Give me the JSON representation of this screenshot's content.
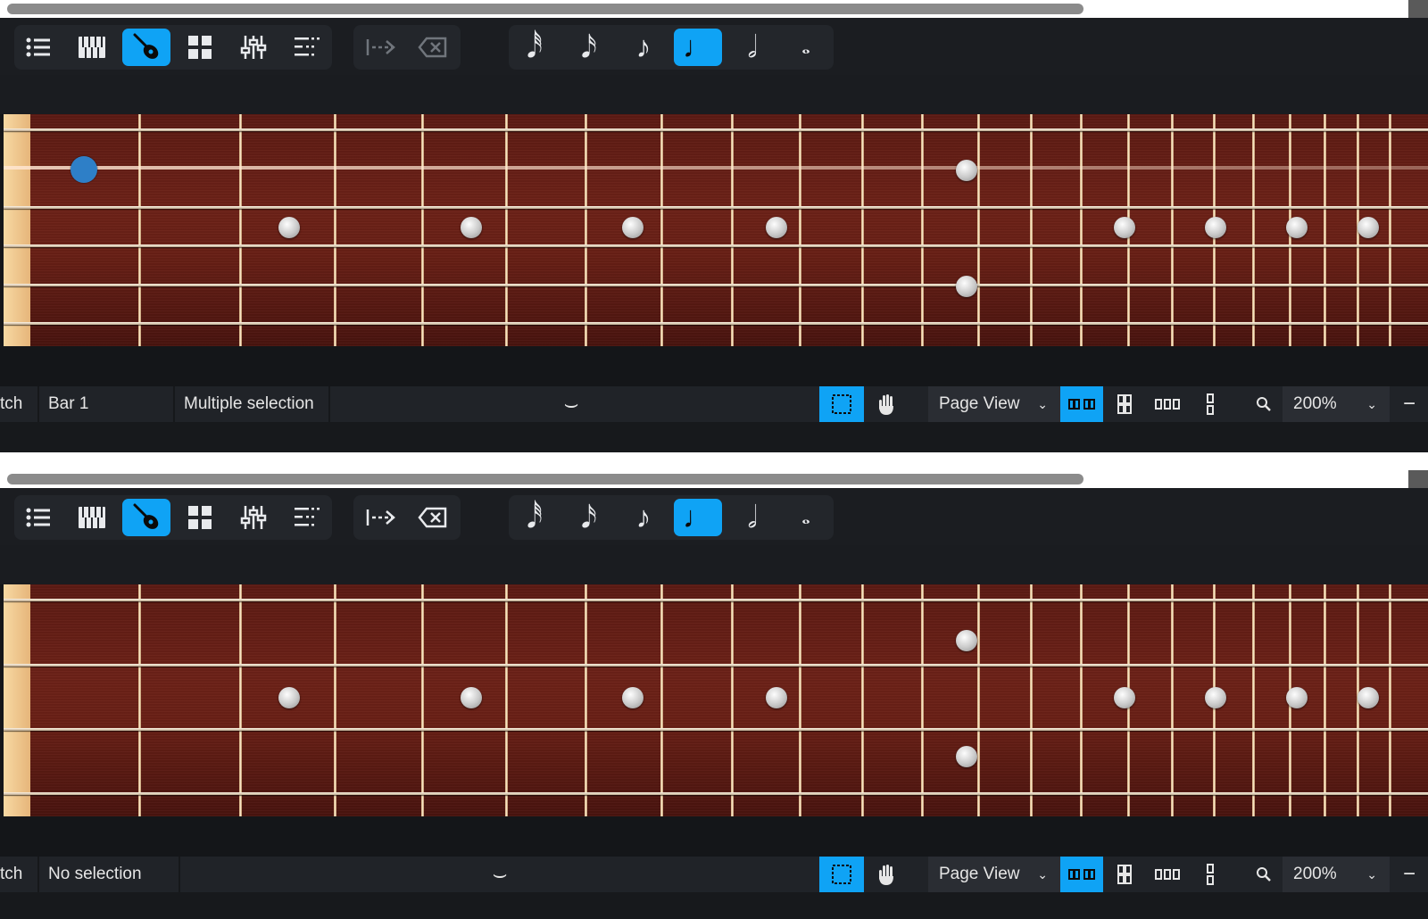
{
  "colors": {
    "accent": "#0fa3f5",
    "toolbar": "#1b1d21",
    "fretboard": "#6a2016",
    "cursor": "#2e7fc7"
  },
  "toolbar": {
    "panels": [
      {
        "name": "list-icon"
      },
      {
        "name": "piano-icon"
      },
      {
        "name": "guitar-icon",
        "active": true
      },
      {
        "name": "grid-icon"
      },
      {
        "name": "mixer-icon"
      },
      {
        "name": "align-icon"
      }
    ],
    "actions": [
      {
        "name": "insert-arrow-icon"
      },
      {
        "name": "delete-icon"
      }
    ],
    "durations": [
      {
        "name": "32nd-note-icon",
        "glyph": "𝅘𝅥𝅰"
      },
      {
        "name": "16th-note-icon",
        "glyph": "𝅘𝅥𝅯"
      },
      {
        "name": "8th-note-icon",
        "glyph": "♪"
      },
      {
        "name": "quarter-note-icon",
        "glyph": "♩",
        "active": true
      },
      {
        "name": "half-note-icon",
        "glyph": "𝅗𝅥"
      },
      {
        "name": "whole-note-icon",
        "glyph": "𝅝"
      }
    ]
  },
  "panel_top": {
    "status": {
      "left_cut": "tch",
      "bar": "Bar 1",
      "selection": "Multiple selection"
    }
  },
  "panel_bottom": {
    "status": {
      "left_cut": "tch",
      "selection": "No selection"
    }
  },
  "statusbar_common": {
    "view_mode": "Page View",
    "zoom": "200%",
    "collapse_glyph": "⌣"
  }
}
